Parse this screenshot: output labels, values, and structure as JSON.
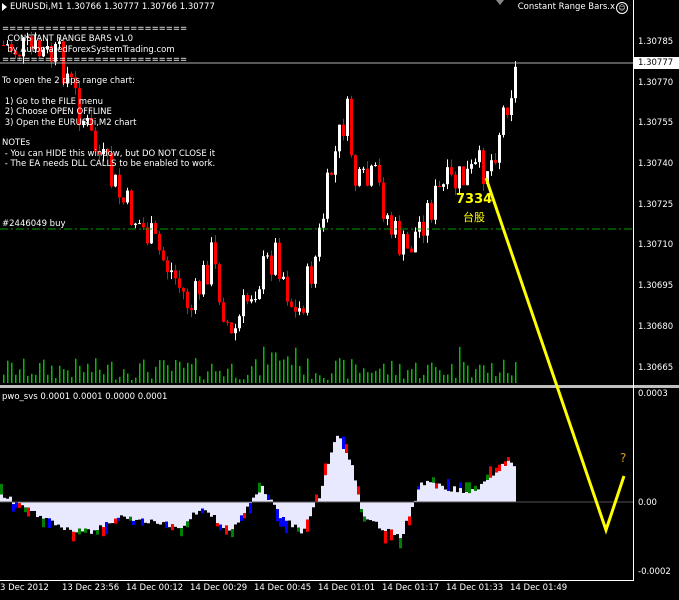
{
  "header": {
    "symbol_info": "EURUSDi,M1  1.30766 1.30777 1.30766 1.30777",
    "ea_title": "Constant Range Bars.x"
  },
  "info_box": {
    "lines": [
      "==========================",
      "  CONSTANT RANGE BARS v1.0",
      "  by AutomatedForexSystemTrading.com",
      "==========================",
      "",
      "To open the 2 pips range chart:",
      "",
      " 1) Go to the FILE menu",
      " 2) Choose OPEN OFFLINE",
      " 3) Open the EURUSDi,M2 chart",
      "",
      "NOTEs",
      " - You can HIDE this window, but DO NOT CLOSE it",
      " - The EA needs DLL CALLS to be enabled to work."
    ]
  },
  "order_label": "#2446049 buy",
  "price_axis": {
    "labels": [
      "1.30785",
      "1.30770",
      "1.30755",
      "1.30740",
      "1.30725",
      "1.30710",
      "1.30695",
      "1.30680",
      "1.30665"
    ],
    "current_price": "1.30777"
  },
  "indicator": {
    "label": "pwo_svs 0.0001 0.0001 0.0000 0.0001",
    "axis_labels": [
      "0.0003",
      "0.00",
      "-0.0002"
    ]
  },
  "time_axis": {
    "labels": [
      "3 Dec 2012",
      "13 Dec 23:56",
      "14 Dec 00:12",
      "14 Dec 00:29",
      "14 Dec 00:45",
      "14 Dec 01:01",
      "14 Dec 01:17",
      "14 Dec 01:33",
      "14 Dec 01:49"
    ]
  },
  "annotation": {
    "number": "7334",
    "text": "台股",
    "question": "?"
  },
  "colors": {
    "bull": "#ffffff",
    "bear": "#ff0000",
    "volume": "#00c000",
    "order_line": "#00a000",
    "hist_main": "#e8e8ff",
    "hist_red": "#ff0000",
    "hist_blue": "#0000ff",
    "hist_green": "#008000",
    "annotation": "#ffff00"
  }
}
